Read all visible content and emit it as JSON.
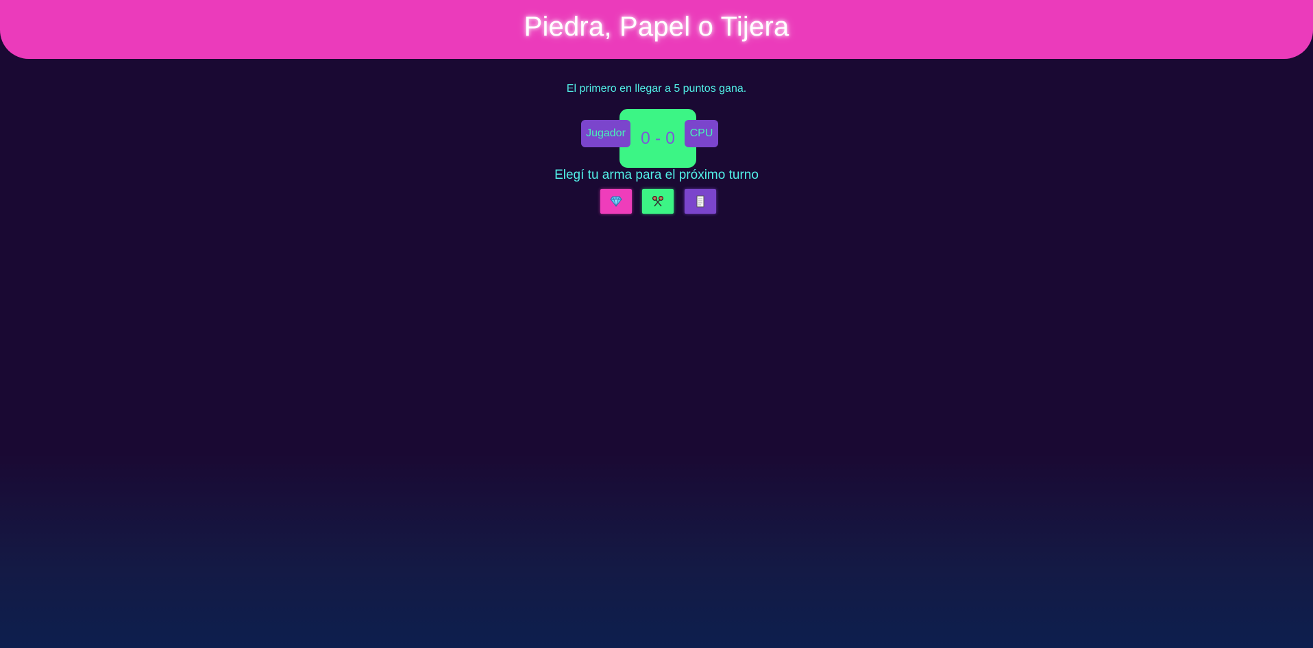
{
  "header": {
    "title": "Piedra, Papel o Tijera"
  },
  "rules": {
    "text": "El primero en llegar a 5 puntos gana."
  },
  "scoreboard": {
    "player_label": "Jugador",
    "score": "0 - 0",
    "cpu_label": "CPU"
  },
  "prompt": {
    "text": "Elegí tu arma para el próximo turno"
  },
  "weapons": [
    {
      "name": "piedra",
      "icon": "gem-icon",
      "color": "#ef3dbb"
    },
    {
      "name": "tijera",
      "icon": "scissors-icon",
      "color": "#3cf585"
    },
    {
      "name": "papel",
      "icon": "paper-icon",
      "color": "#7b45cc"
    }
  ],
  "colors": {
    "header_bg": "#eb3bbb",
    "page_bg": "#1a0933",
    "accent_text": "#52f1e8",
    "score_bg": "#3cf585",
    "tag_bg": "#7b45cc"
  }
}
